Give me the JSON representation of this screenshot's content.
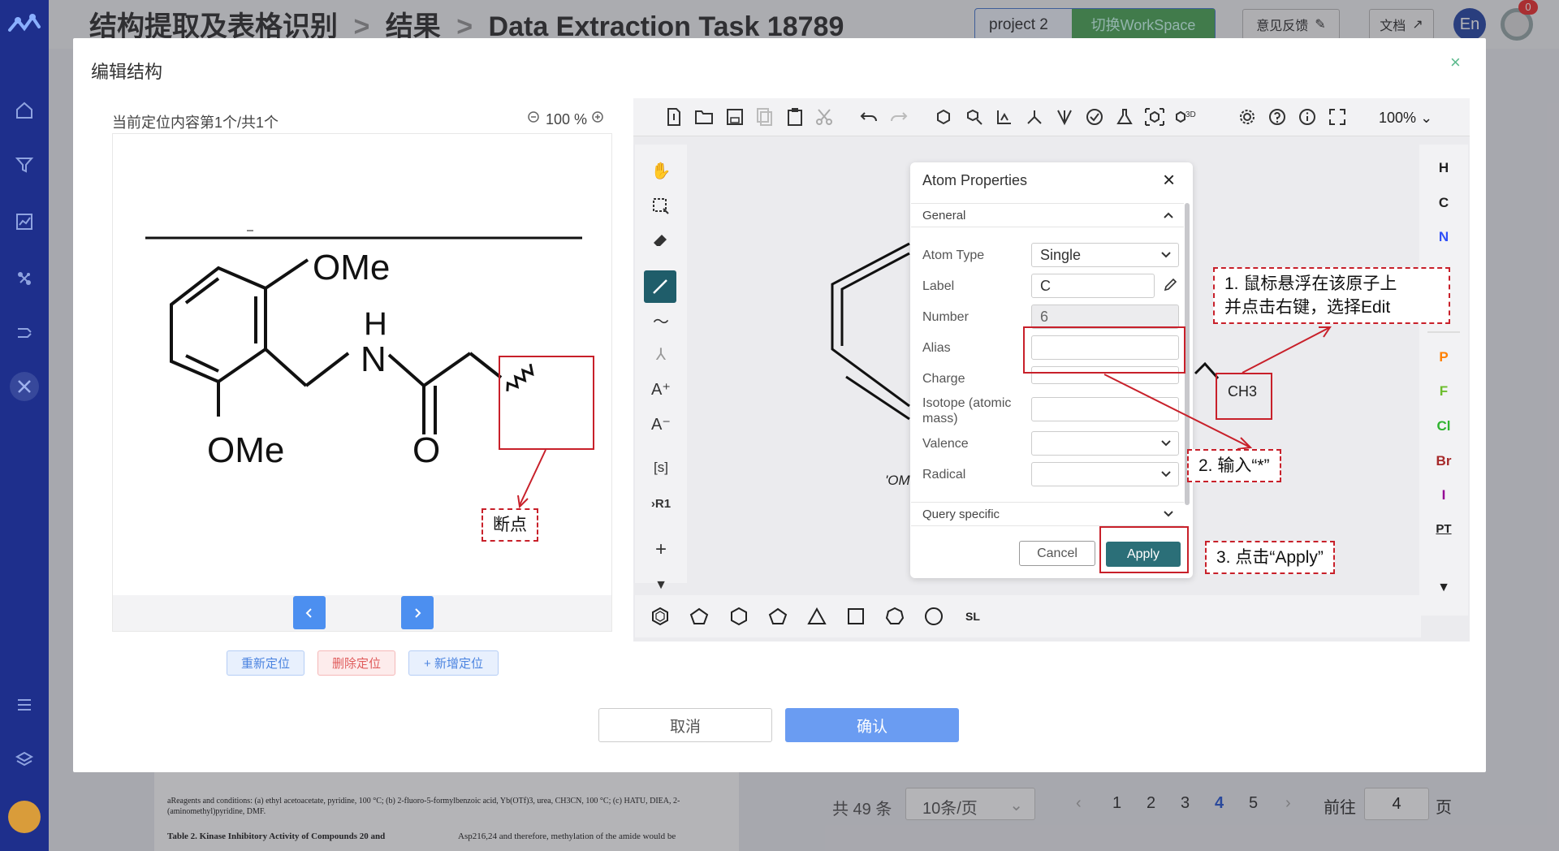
{
  "header": {
    "breadcrumb": [
      "结构提取及表格识别",
      "结果",
      "Data Extraction Task 18789"
    ],
    "separator": ">",
    "project_name": "project 2",
    "switch_workspace": "切换WorkSpace",
    "feedback": "意见反馈",
    "docs": "文档",
    "language": "En",
    "notification_count": "0"
  },
  "modal": {
    "title": "编辑结构",
    "close": "×",
    "location_text": "当前定位内容第1个/共1个",
    "zoom": "100 %",
    "actions": [
      "重新定位",
      "删除定位",
      "+ 新增定位"
    ],
    "footer_cancel": "取消",
    "footer_confirm": "确认"
  },
  "molecule": {
    "ome_top": "OMe",
    "ome_bottom": "OMe",
    "nh_h": "H",
    "nh_n": "N",
    "carbonyl_o": "O"
  },
  "editor": {
    "zoom_level": "100%",
    "elements": [
      "H",
      "C",
      "N",
      "P",
      "F",
      "Cl",
      "Br",
      "I",
      "PT"
    ],
    "element_colors": {
      "H": "#222222",
      "C": "#222222",
      "N": "#3050f8",
      "P": "#ff8000",
      "F": "#6cbd2d",
      "Cl": "#2fb32f",
      "Br": "#a62929",
      "I": "#940094",
      "PT": "#222222"
    },
    "canvas_label_ch3": "CH3",
    "canvas_label_om": "'OM",
    "bottom_sl": "SL"
  },
  "atom_dialog": {
    "title": "Atom Properties",
    "section_general": "General",
    "section_query": "Query specific",
    "fields": {
      "atom_type_label": "Atom Type",
      "atom_type_value": "Single",
      "label_label": "Label",
      "label_value": "C",
      "number_label": "Number",
      "number_value": "6",
      "alias_label": "Alias",
      "charge_label": "Charge",
      "isotope_label": "Isotope (atomic mass)",
      "valence_label": "Valence",
      "radical_label": "Radical"
    },
    "cancel": "Cancel",
    "apply": "Apply"
  },
  "annotations": {
    "breakpoint": "断点",
    "step1_line1": "1. 鼠标悬浮在该原子上",
    "step1_line2": "并点击右键，选择Edit",
    "step2": "2. 输入“*”",
    "step3": "3. 点击“Apply”"
  },
  "pagination": {
    "total": "共 49 条",
    "page_size": "10条/页",
    "pages": [
      "1",
      "2",
      "3",
      "4",
      "5"
    ],
    "current_page": "4",
    "goto_label": "前往",
    "goto_value": "4",
    "page_suffix": "页"
  },
  "document_peek": {
    "footnote": "aReagents and conditions: (a) ethyl acetoacetate, pyridine, 100 °C; (b) 2-fluoro-5-formylbenzoic acid, Yb(OTf)3, urea, CH3CN, 100 °C; (c) HATU, DIEA, 2-(aminomethyl)pyridine, DMF.",
    "table_caption": "Table 2. Kinase Inhibitory Activity of Compounds 20 and",
    "side_text": "Asp216,24 and therefore, methylation of the amide would be"
  }
}
